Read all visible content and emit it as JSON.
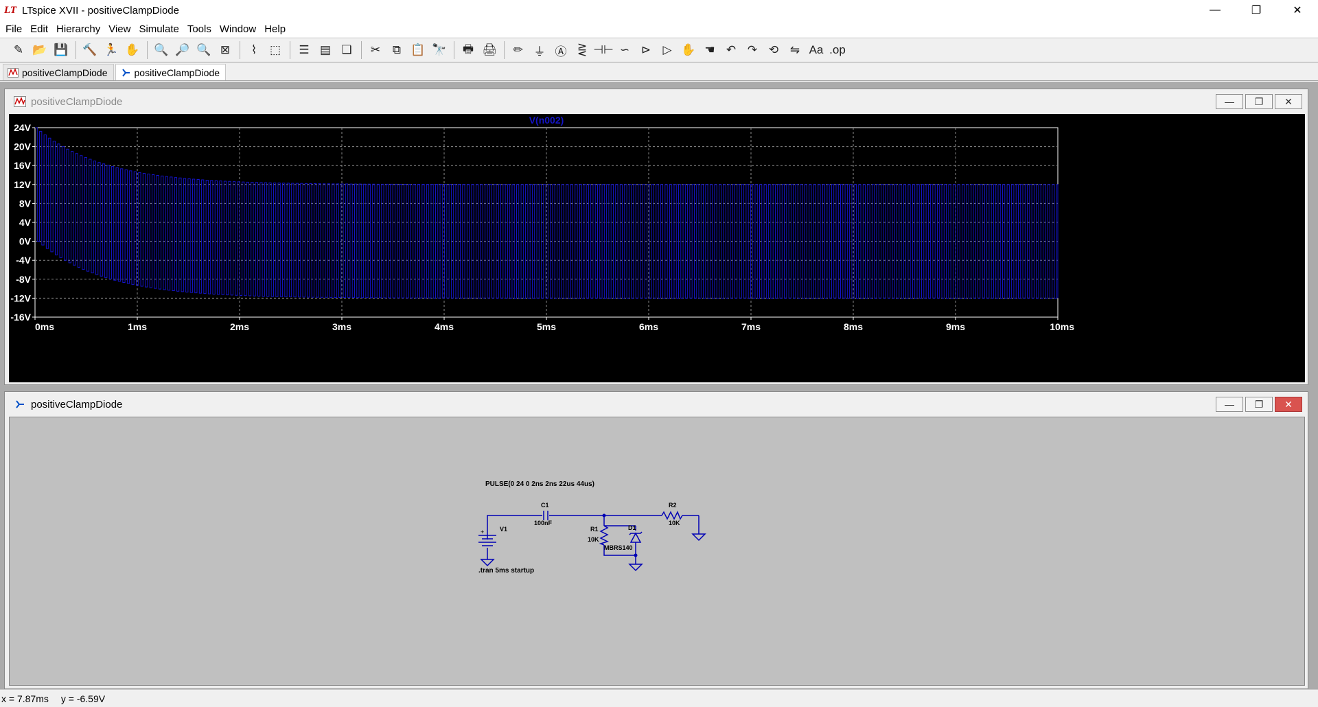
{
  "app": {
    "title": "LTspice XVII - positiveClampDiode",
    "logo_text": "LT"
  },
  "window_controls": {
    "minimize": "—",
    "restore": "❐",
    "close": "✕"
  },
  "menu": [
    "File",
    "Edit",
    "Hierarchy",
    "View",
    "Simulate",
    "Tools",
    "Window",
    "Help"
  ],
  "toolbar": {
    "groups": [
      [
        {
          "name": "new-schematic",
          "glyph": "✎"
        },
        {
          "name": "open",
          "glyph": "📂"
        },
        {
          "name": "save",
          "glyph": "💾"
        }
      ],
      [
        {
          "name": "control-panel",
          "glyph": "🔨"
        },
        {
          "name": "run",
          "glyph": "🏃"
        },
        {
          "name": "halt",
          "glyph": "✋"
        }
      ],
      [
        {
          "name": "zoom-in",
          "glyph": "🔍"
        },
        {
          "name": "pan",
          "glyph": "🔎"
        },
        {
          "name": "zoom-out",
          "glyph": "🔍"
        },
        {
          "name": "zoom-fit",
          "glyph": "⊠"
        }
      ],
      [
        {
          "name": "autorange",
          "glyph": "⌇"
        },
        {
          "name": "delete-plot",
          "glyph": "⬚"
        }
      ],
      [
        {
          "name": "tile-horizontal",
          "glyph": "☰"
        },
        {
          "name": "tile-vertical",
          "glyph": "▤"
        },
        {
          "name": "cascade",
          "glyph": "❏"
        }
      ],
      [
        {
          "name": "cut",
          "glyph": "✂"
        },
        {
          "name": "copy",
          "glyph": "⧉"
        },
        {
          "name": "paste",
          "glyph": "📋"
        },
        {
          "name": "find",
          "glyph": "🔭"
        }
      ],
      [
        {
          "name": "print",
          "glyph": "🖶"
        },
        {
          "name": "print-preview",
          "glyph": "🖨"
        }
      ],
      [
        {
          "name": "draw-wire",
          "glyph": "✏"
        },
        {
          "name": "ground",
          "glyph": "⏚"
        },
        {
          "name": "label-net",
          "glyph": "Ⓐ"
        },
        {
          "name": "resistor",
          "glyph": "⋛"
        },
        {
          "name": "capacitor",
          "glyph": "⊣⊢"
        },
        {
          "name": "inductor",
          "glyph": "∽"
        },
        {
          "name": "diode",
          "glyph": "⊳"
        },
        {
          "name": "component",
          "glyph": "▷"
        },
        {
          "name": "move",
          "glyph": "✋"
        },
        {
          "name": "drag",
          "glyph": "☚"
        },
        {
          "name": "undo",
          "glyph": "↶"
        },
        {
          "name": "redo",
          "glyph": "↷"
        },
        {
          "name": "rotate",
          "glyph": "⟲"
        },
        {
          "name": "mirror",
          "glyph": "⇋"
        },
        {
          "name": "text",
          "glyph": "Aa"
        },
        {
          "name": "spice-directive",
          "glyph": ".op"
        }
      ]
    ]
  },
  "tabs": [
    {
      "label": "positiveClampDiode",
      "icon": "waveform",
      "active": false
    },
    {
      "label": "positiveClampDiode",
      "icon": "schematic",
      "active": true
    }
  ],
  "plot_window": {
    "title": "positiveClampDiode",
    "trace_label": "V(n002)",
    "trace_color": "#1414c8",
    "chart_data": {
      "type": "line",
      "series": [
        {
          "name": "V(n002)"
        }
      ],
      "xlim": [
        0,
        10
      ],
      "ylim": [
        -16,
        24
      ],
      "x_ticks": [
        "0ms",
        "1ms",
        "2ms",
        "3ms",
        "4ms",
        "5ms",
        "6ms",
        "7ms",
        "8ms",
        "9ms",
        "10ms"
      ],
      "y_ticks": [
        "24V",
        "20V",
        "16V",
        "12V",
        "8V",
        "4V",
        "0V",
        "-4V",
        "-8V",
        "-12V",
        "-16V"
      ],
      "upper_envelope": {
        "start": 24,
        "settle": 12,
        "tau_ms": 0.65
      },
      "lower_envelope": {
        "start": 0,
        "settle": -12,
        "tau_ms": 0.65
      },
      "period_us": 44,
      "grid": true
    }
  },
  "schematic_window": {
    "title": "positiveClampDiode",
    "pulse_directive": "PULSE(0 24 0 2ns 2ns 22us 44us)",
    "tran_directive": ".tran 5ms startup",
    "components": {
      "v1": {
        "ref": "V1"
      },
      "c1": {
        "ref": "C1",
        "value": "100nF"
      },
      "r1": {
        "ref": "R1",
        "value": "10K"
      },
      "d1": {
        "ref": "D1",
        "value": "MBRS140"
      },
      "r2": {
        "ref": "R2",
        "value": "10K"
      }
    },
    "wire_color": "#0000b4"
  },
  "status": {
    "x": "x = 7.87ms",
    "y": "y = -6.59V"
  }
}
